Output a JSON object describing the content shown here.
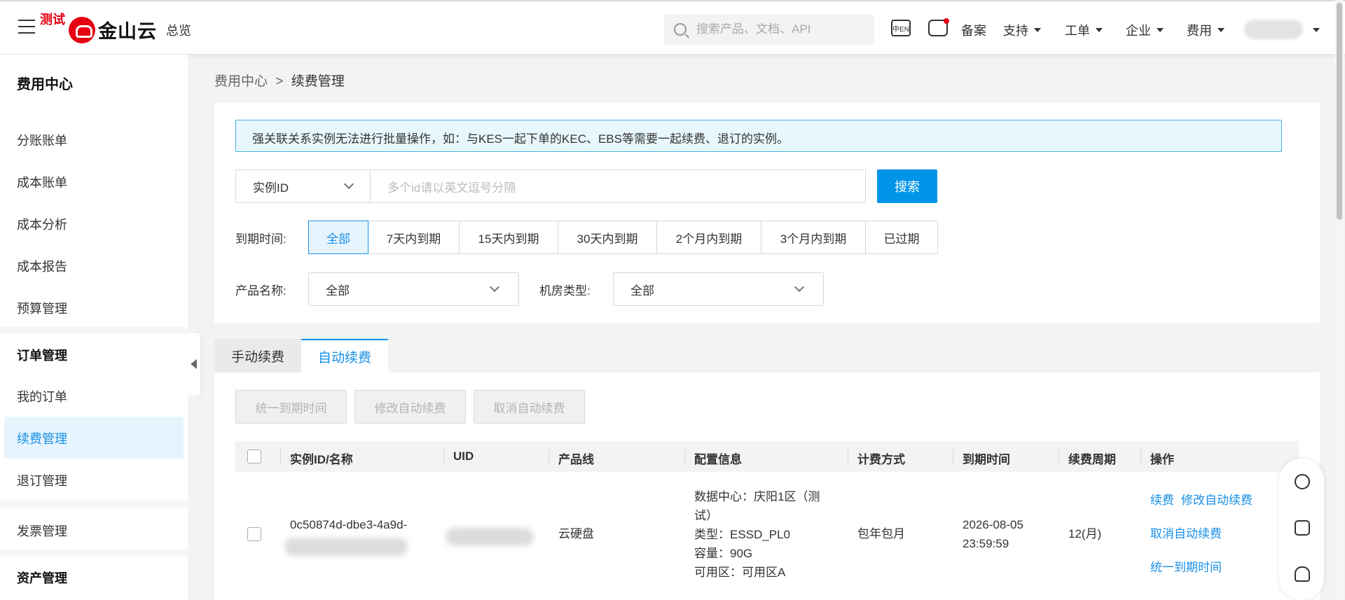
{
  "topbar": {
    "test_badge": "测试",
    "logo_text": "金山云",
    "overview": "总览",
    "search_placeholder": "搜索产品、文档、API",
    "lang_icon_text": "中EN",
    "links": {
      "filing": "备案",
      "support": "支持",
      "tickets": "工单",
      "enterprise": "企业",
      "billing": "费用"
    }
  },
  "sidebar": {
    "title": "费用中心",
    "items": [
      "分账账单",
      "成本账单",
      "成本分析",
      "成本报告",
      "预算管理"
    ],
    "order_section": "订单管理",
    "order_items": [
      "我的订单",
      "续费管理",
      "退订管理"
    ],
    "invoice": "发票管理",
    "asset_section": "资产管理"
  },
  "breadcrumb": {
    "parent": "费用中心",
    "separator": ">",
    "current": "续费管理"
  },
  "notice": "强关联关系实例无法进行批量操作，如：与KES一起下单的KEC、EBS等需要一起续费、退订的实例。",
  "search": {
    "field_select": "实例ID",
    "input_placeholder": "多个id请以英文逗号分隔",
    "button": "搜索"
  },
  "filters": {
    "expiry_label": "到期时间:",
    "expiry_options": [
      "全部",
      "7天内到期",
      "15天内到期",
      "30天内到期",
      "2个月内到期",
      "3个月内到期",
      "已过期"
    ],
    "product_label": "产品名称:",
    "product_value": "全部",
    "room_label": "机房类型:",
    "room_value": "全部"
  },
  "tabs": [
    "手动续费",
    "自动续费"
  ],
  "actions": [
    "统一到期时间",
    "修改自动续费",
    "取消自动续费"
  ],
  "table": {
    "headers": [
      "实例ID/名称",
      "UID",
      "产品线",
      "配置信息",
      "计费方式",
      "到期时间",
      "续费周期",
      "操作"
    ],
    "rows": [
      {
        "instance_id": "0c50874d-dbe3-4a9d-",
        "product": "云硬盘",
        "config": [
          "数据中心：庆阳1区（测",
          "试）",
          "类型：ESSD_PL0",
          "容量：90G",
          "可用区：可用区A"
        ],
        "billing": "包年包月",
        "expire_date": "2026-08-05",
        "expire_time": "23:59:59",
        "period": "12(月)",
        "ops": [
          "续费",
          "修改自动续费",
          "取消自动续费",
          "统一到期时间"
        ]
      }
    ]
  },
  "colors": {
    "accent": "#1890e6",
    "primary_button": "#0095e8",
    "brand_red": "#e60012"
  }
}
